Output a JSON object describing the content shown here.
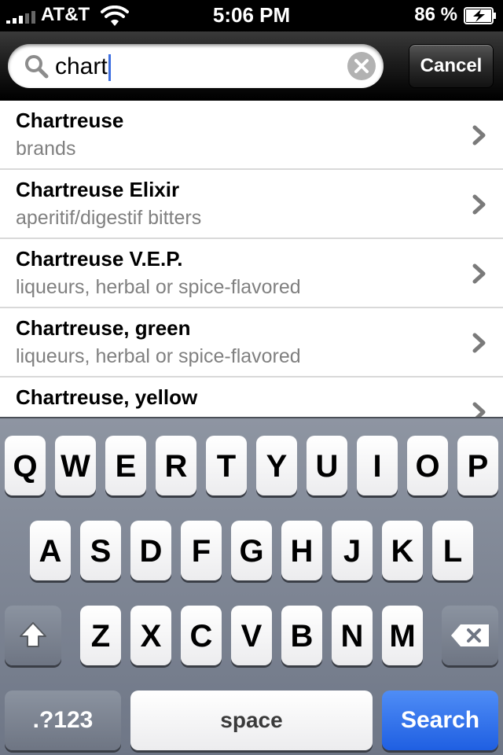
{
  "status_bar": {
    "carrier": "AT&T",
    "time": "5:06 PM",
    "battery_percent": "86 %",
    "signal_bars": 5,
    "signal_bars_active": 3
  },
  "search": {
    "value": "chart",
    "cancel_label": "Cancel"
  },
  "results": [
    {
      "title": "Chartreuse",
      "subtitle": "brands"
    },
    {
      "title": "Chartreuse Elixir",
      "subtitle": "aperitif/digestif bitters"
    },
    {
      "title": "Chartreuse V.E.P.",
      "subtitle": "liqueurs, herbal or spice-flavored"
    },
    {
      "title": "Chartreuse, green",
      "subtitle": "liqueurs, herbal or spice-flavored"
    },
    {
      "title": "Chartreuse, yellow",
      "subtitle": ""
    }
  ],
  "keyboard": {
    "row1": [
      "Q",
      "W",
      "E",
      "R",
      "T",
      "Y",
      "U",
      "I",
      "O",
      "P"
    ],
    "row2": [
      "A",
      "S",
      "D",
      "F",
      "G",
      "H",
      "J",
      "K",
      "L"
    ],
    "row3": [
      "Z",
      "X",
      "C",
      "V",
      "B",
      "N",
      "M"
    ],
    "mode_label": ".?123",
    "space_label": "space",
    "search_label": "Search"
  },
  "colors": {
    "search_key": "#2a6ae8",
    "caret": "#3d6fe0",
    "subtitle_gray": "#808080"
  }
}
